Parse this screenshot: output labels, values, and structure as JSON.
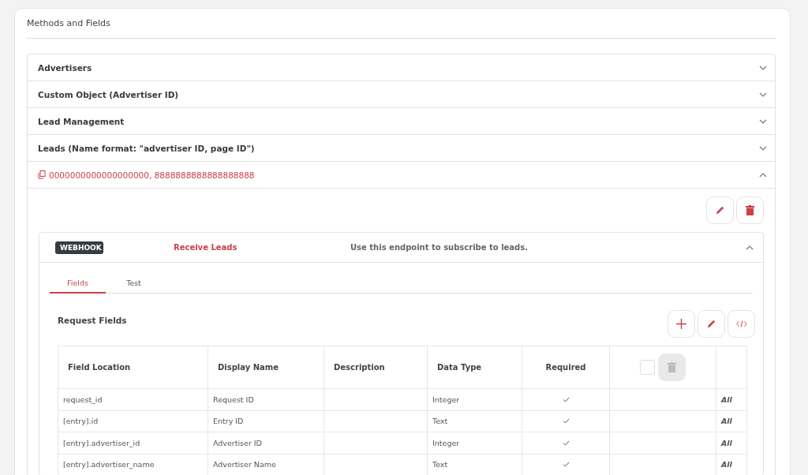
{
  "title": "Methods and Fields",
  "sections": [
    {
      "label": "Advertisers",
      "expanded": false
    },
    {
      "label": "Custom Object (Advertiser ID)",
      "expanded": false
    },
    {
      "label": "Lead Management",
      "expanded": false
    },
    {
      "label": "Leads (Name format: \"advertiser ID, page ID\")",
      "expanded": false
    },
    {
      "label": "0000000000000000000, 8888888888888888888",
      "expanded": true,
      "kind": "ids"
    }
  ],
  "endpoint": {
    "badge": "WEBHOOK",
    "name": "Receive Leads",
    "description": "Use this endpoint to subscribe to leads.",
    "expanded": true
  },
  "tabs": [
    {
      "label": "Fields",
      "selected": true
    },
    {
      "label": "Test",
      "selected": false
    }
  ],
  "request_fields": {
    "title": "Request Fields",
    "columns": [
      "Field Location",
      "Display Name",
      "Description",
      "Data Type",
      "Required"
    ],
    "select_all_checked": false,
    "delete_disabled": true,
    "rows": [
      {
        "location": "request_id",
        "display_name": "Request ID",
        "data_type": "Integer",
        "required": true,
        "column_7": "All"
      },
      {
        "location": "[entry].id",
        "display_name": "Entry ID",
        "data_type": "Text",
        "required": true,
        "column_7": "All"
      },
      {
        "location": "[entry].advertiser_id",
        "display_name": "Advertiser ID",
        "data_type": "Integer",
        "required": true,
        "column_7": "All"
      },
      {
        "location": "[entry].advertiser_name",
        "display_name": "Advertiser Name",
        "data_type": "Text",
        "required": true,
        "column_7": "All"
      }
    ]
  }
}
